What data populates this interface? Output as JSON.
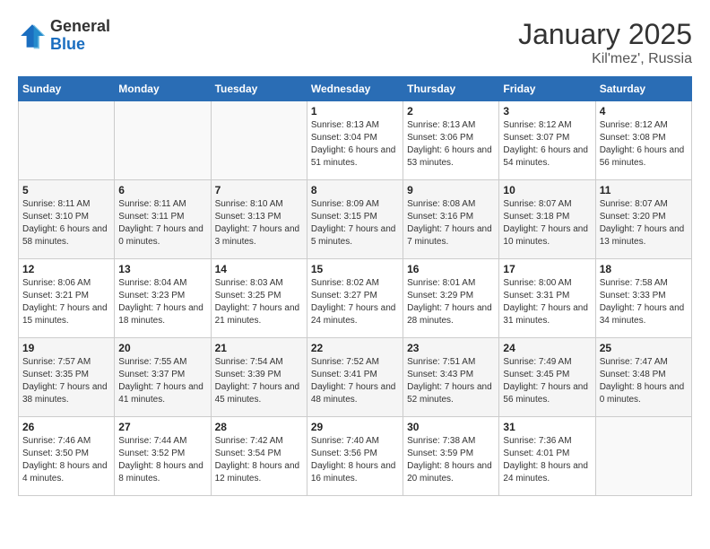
{
  "logo": {
    "general": "General",
    "blue": "Blue"
  },
  "title": "January 2025",
  "location": "Kil'mez', Russia",
  "weekdays": [
    "Sunday",
    "Monday",
    "Tuesday",
    "Wednesday",
    "Thursday",
    "Friday",
    "Saturday"
  ],
  "weeks": [
    [
      {
        "day": "",
        "info": ""
      },
      {
        "day": "",
        "info": ""
      },
      {
        "day": "",
        "info": ""
      },
      {
        "day": "1",
        "info": "Sunrise: 8:13 AM\nSunset: 3:04 PM\nDaylight: 6 hours and 51 minutes."
      },
      {
        "day": "2",
        "info": "Sunrise: 8:13 AM\nSunset: 3:06 PM\nDaylight: 6 hours and 53 minutes."
      },
      {
        "day": "3",
        "info": "Sunrise: 8:12 AM\nSunset: 3:07 PM\nDaylight: 6 hours and 54 minutes."
      },
      {
        "day": "4",
        "info": "Sunrise: 8:12 AM\nSunset: 3:08 PM\nDaylight: 6 hours and 56 minutes."
      }
    ],
    [
      {
        "day": "5",
        "info": "Sunrise: 8:11 AM\nSunset: 3:10 PM\nDaylight: 6 hours and 58 minutes."
      },
      {
        "day": "6",
        "info": "Sunrise: 8:11 AM\nSunset: 3:11 PM\nDaylight: 7 hours and 0 minutes."
      },
      {
        "day": "7",
        "info": "Sunrise: 8:10 AM\nSunset: 3:13 PM\nDaylight: 7 hours and 3 minutes."
      },
      {
        "day": "8",
        "info": "Sunrise: 8:09 AM\nSunset: 3:15 PM\nDaylight: 7 hours and 5 minutes."
      },
      {
        "day": "9",
        "info": "Sunrise: 8:08 AM\nSunset: 3:16 PM\nDaylight: 7 hours and 7 minutes."
      },
      {
        "day": "10",
        "info": "Sunrise: 8:07 AM\nSunset: 3:18 PM\nDaylight: 7 hours and 10 minutes."
      },
      {
        "day": "11",
        "info": "Sunrise: 8:07 AM\nSunset: 3:20 PM\nDaylight: 7 hours and 13 minutes."
      }
    ],
    [
      {
        "day": "12",
        "info": "Sunrise: 8:06 AM\nSunset: 3:21 PM\nDaylight: 7 hours and 15 minutes."
      },
      {
        "day": "13",
        "info": "Sunrise: 8:04 AM\nSunset: 3:23 PM\nDaylight: 7 hours and 18 minutes."
      },
      {
        "day": "14",
        "info": "Sunrise: 8:03 AM\nSunset: 3:25 PM\nDaylight: 7 hours and 21 minutes."
      },
      {
        "day": "15",
        "info": "Sunrise: 8:02 AM\nSunset: 3:27 PM\nDaylight: 7 hours and 24 minutes."
      },
      {
        "day": "16",
        "info": "Sunrise: 8:01 AM\nSunset: 3:29 PM\nDaylight: 7 hours and 28 minutes."
      },
      {
        "day": "17",
        "info": "Sunrise: 8:00 AM\nSunset: 3:31 PM\nDaylight: 7 hours and 31 minutes."
      },
      {
        "day": "18",
        "info": "Sunrise: 7:58 AM\nSunset: 3:33 PM\nDaylight: 7 hours and 34 minutes."
      }
    ],
    [
      {
        "day": "19",
        "info": "Sunrise: 7:57 AM\nSunset: 3:35 PM\nDaylight: 7 hours and 38 minutes."
      },
      {
        "day": "20",
        "info": "Sunrise: 7:55 AM\nSunset: 3:37 PM\nDaylight: 7 hours and 41 minutes."
      },
      {
        "day": "21",
        "info": "Sunrise: 7:54 AM\nSunset: 3:39 PM\nDaylight: 7 hours and 45 minutes."
      },
      {
        "day": "22",
        "info": "Sunrise: 7:52 AM\nSunset: 3:41 PM\nDaylight: 7 hours and 48 minutes."
      },
      {
        "day": "23",
        "info": "Sunrise: 7:51 AM\nSunset: 3:43 PM\nDaylight: 7 hours and 52 minutes."
      },
      {
        "day": "24",
        "info": "Sunrise: 7:49 AM\nSunset: 3:45 PM\nDaylight: 7 hours and 56 minutes."
      },
      {
        "day": "25",
        "info": "Sunrise: 7:47 AM\nSunset: 3:48 PM\nDaylight: 8 hours and 0 minutes."
      }
    ],
    [
      {
        "day": "26",
        "info": "Sunrise: 7:46 AM\nSunset: 3:50 PM\nDaylight: 8 hours and 4 minutes."
      },
      {
        "day": "27",
        "info": "Sunrise: 7:44 AM\nSunset: 3:52 PM\nDaylight: 8 hours and 8 minutes."
      },
      {
        "day": "28",
        "info": "Sunrise: 7:42 AM\nSunset: 3:54 PM\nDaylight: 8 hours and 12 minutes."
      },
      {
        "day": "29",
        "info": "Sunrise: 7:40 AM\nSunset: 3:56 PM\nDaylight: 8 hours and 16 minutes."
      },
      {
        "day": "30",
        "info": "Sunrise: 7:38 AM\nSunset: 3:59 PM\nDaylight: 8 hours and 20 minutes."
      },
      {
        "day": "31",
        "info": "Sunrise: 7:36 AM\nSunset: 4:01 PM\nDaylight: 8 hours and 24 minutes."
      },
      {
        "day": "",
        "info": ""
      }
    ]
  ]
}
